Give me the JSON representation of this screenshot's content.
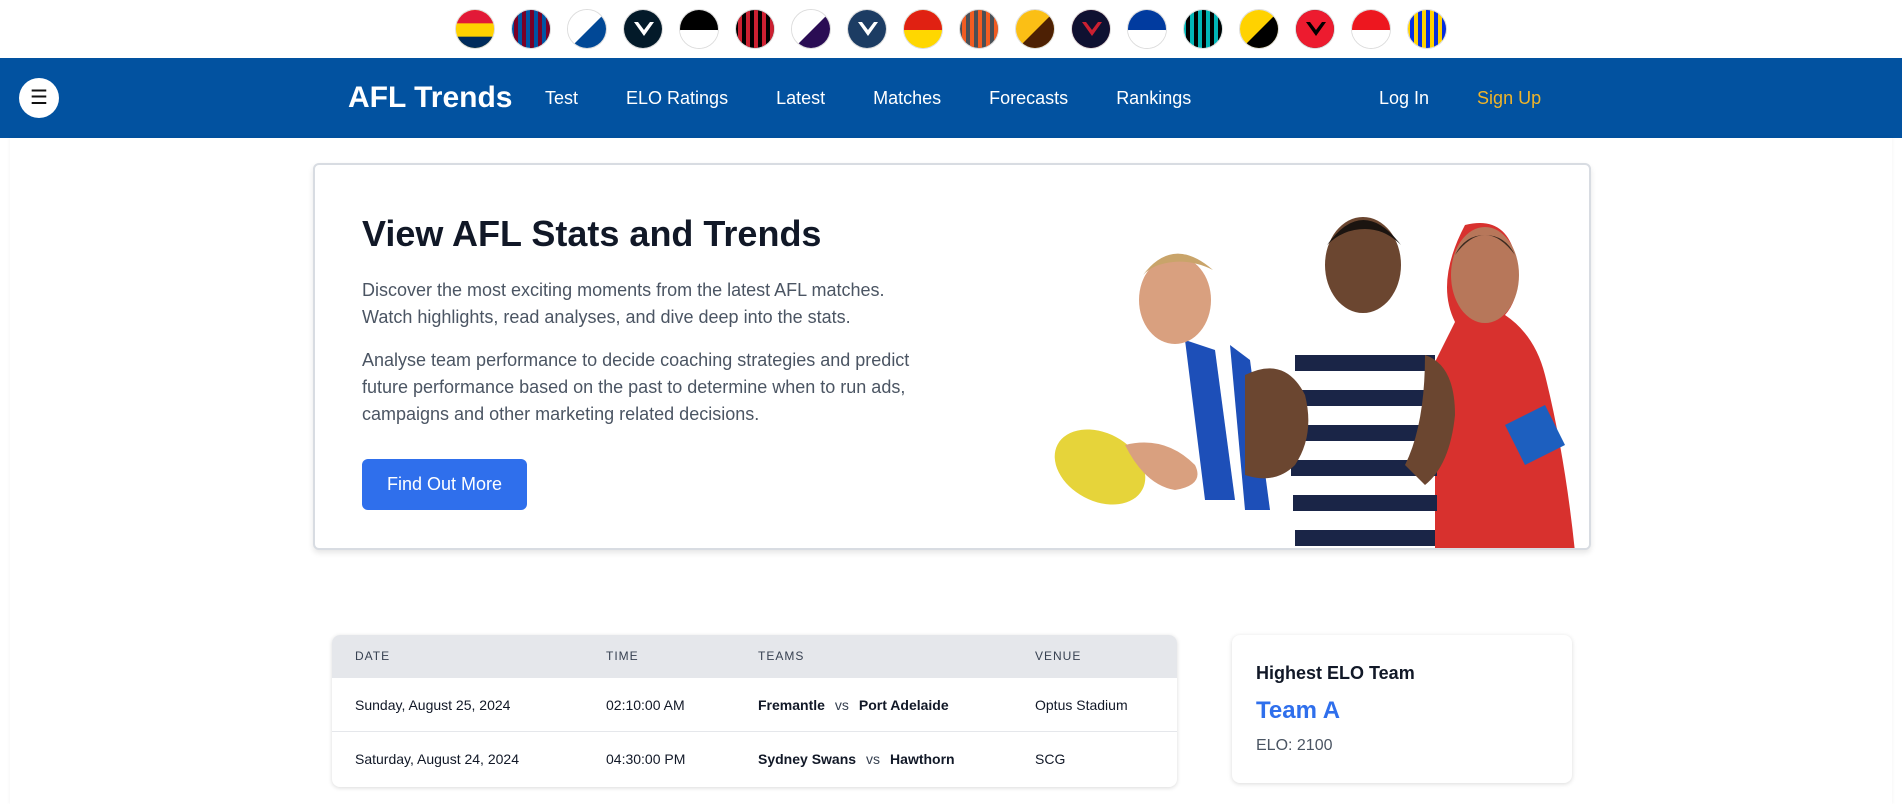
{
  "teams": [
    {
      "icon": "adelaide-crows-icon",
      "colors": [
        "#e21937",
        "#ffd200",
        "#002b5c"
      ]
    },
    {
      "icon": "brisbane-lions-icon",
      "colors": [
        "#7a0026",
        "#0054a4",
        "#fdbe57"
      ]
    },
    {
      "icon": "western-bulldogs-icon",
      "colors": [
        "#014896",
        "#ffffff",
        "#e31937"
      ]
    },
    {
      "icon": "carlton-icon",
      "colors": [
        "#031a29",
        "#ffffff"
      ]
    },
    {
      "icon": "collingwood-icon",
      "colors": [
        "#000000",
        "#ffffff"
      ]
    },
    {
      "icon": "essendon-icon",
      "colors": [
        "#cc2031",
        "#000000"
      ]
    },
    {
      "icon": "fremantle-icon",
      "colors": [
        "#2a0d54",
        "#ffffff"
      ]
    },
    {
      "icon": "geelong-icon",
      "colors": [
        "#1c3c63",
        "#ffffff"
      ]
    },
    {
      "icon": "gold-coast-suns-icon",
      "colors": [
        "#e02112",
        "#ffd700"
      ]
    },
    {
      "icon": "gws-giants-icon",
      "colors": [
        "#f15c22",
        "#4a4f55"
      ]
    },
    {
      "icon": "hawthorn-icon",
      "colors": [
        "#4d2004",
        "#fbbf15"
      ]
    },
    {
      "icon": "melbourne-icon",
      "colors": [
        "#0f1131",
        "#cc2031"
      ]
    },
    {
      "icon": "north-melbourne-icon",
      "colors": [
        "#013b9f",
        "#ffffff"
      ]
    },
    {
      "icon": "port-adelaide-icon",
      "colors": [
        "#000000",
        "#01b5b6",
        "#ffffff"
      ]
    },
    {
      "icon": "richmond-icon",
      "colors": [
        "#000000",
        "#ffd200"
      ]
    },
    {
      "icon": "st-kilda-icon",
      "colors": [
        "#ed1b2f",
        "#000000",
        "#ffffff"
      ]
    },
    {
      "icon": "sydney-swans-icon",
      "colors": [
        "#ed171f",
        "#ffffff"
      ]
    },
    {
      "icon": "west-coast-eagles-icon",
      "colors": [
        "#062ee2",
        "#ffd200"
      ]
    }
  ],
  "nav": {
    "brand": "AFL Trends",
    "links": [
      "Test",
      "ELO Ratings",
      "Latest",
      "Matches",
      "Forecasts",
      "Rankings"
    ],
    "login": "Log In",
    "signup": "Sign Up",
    "menu_icon": "hamburger-menu-icon"
  },
  "hero": {
    "title": "View AFL Stats and Trends",
    "paragraph1": "Discover the most exciting moments from the latest AFL matches. Watch highlights, read analyses, and dive deep into the stats.",
    "paragraph2": "Analyse team performance to decide coaching strategies and predict future performance based on the past to determine when to run ads, campaigns and other marketing related decisions.",
    "cta": "Find Out More",
    "image": "afl-players-image"
  },
  "matches": {
    "headers": [
      "DATE",
      "TIME",
      "TEAMS",
      "VENUE"
    ],
    "rows": [
      {
        "date": "Sunday, August 25, 2024",
        "time": "02:10:00 AM",
        "home": "Fremantle",
        "vs": "vs",
        "away": "Port Adelaide",
        "venue": "Optus Stadium"
      },
      {
        "date": "Saturday, August 24, 2024",
        "time": "04:30:00 PM",
        "home": "Sydney Swans",
        "vs": "vs",
        "away": "Hawthorn",
        "venue": "SCG"
      }
    ]
  },
  "elo": {
    "label": "Highest ELO Team",
    "team": "Team A",
    "value": "ELO: 2100"
  },
  "colors": {
    "nav_bg": "#0252a0",
    "accent": "#2f6fec",
    "signup": "#f0b429"
  }
}
